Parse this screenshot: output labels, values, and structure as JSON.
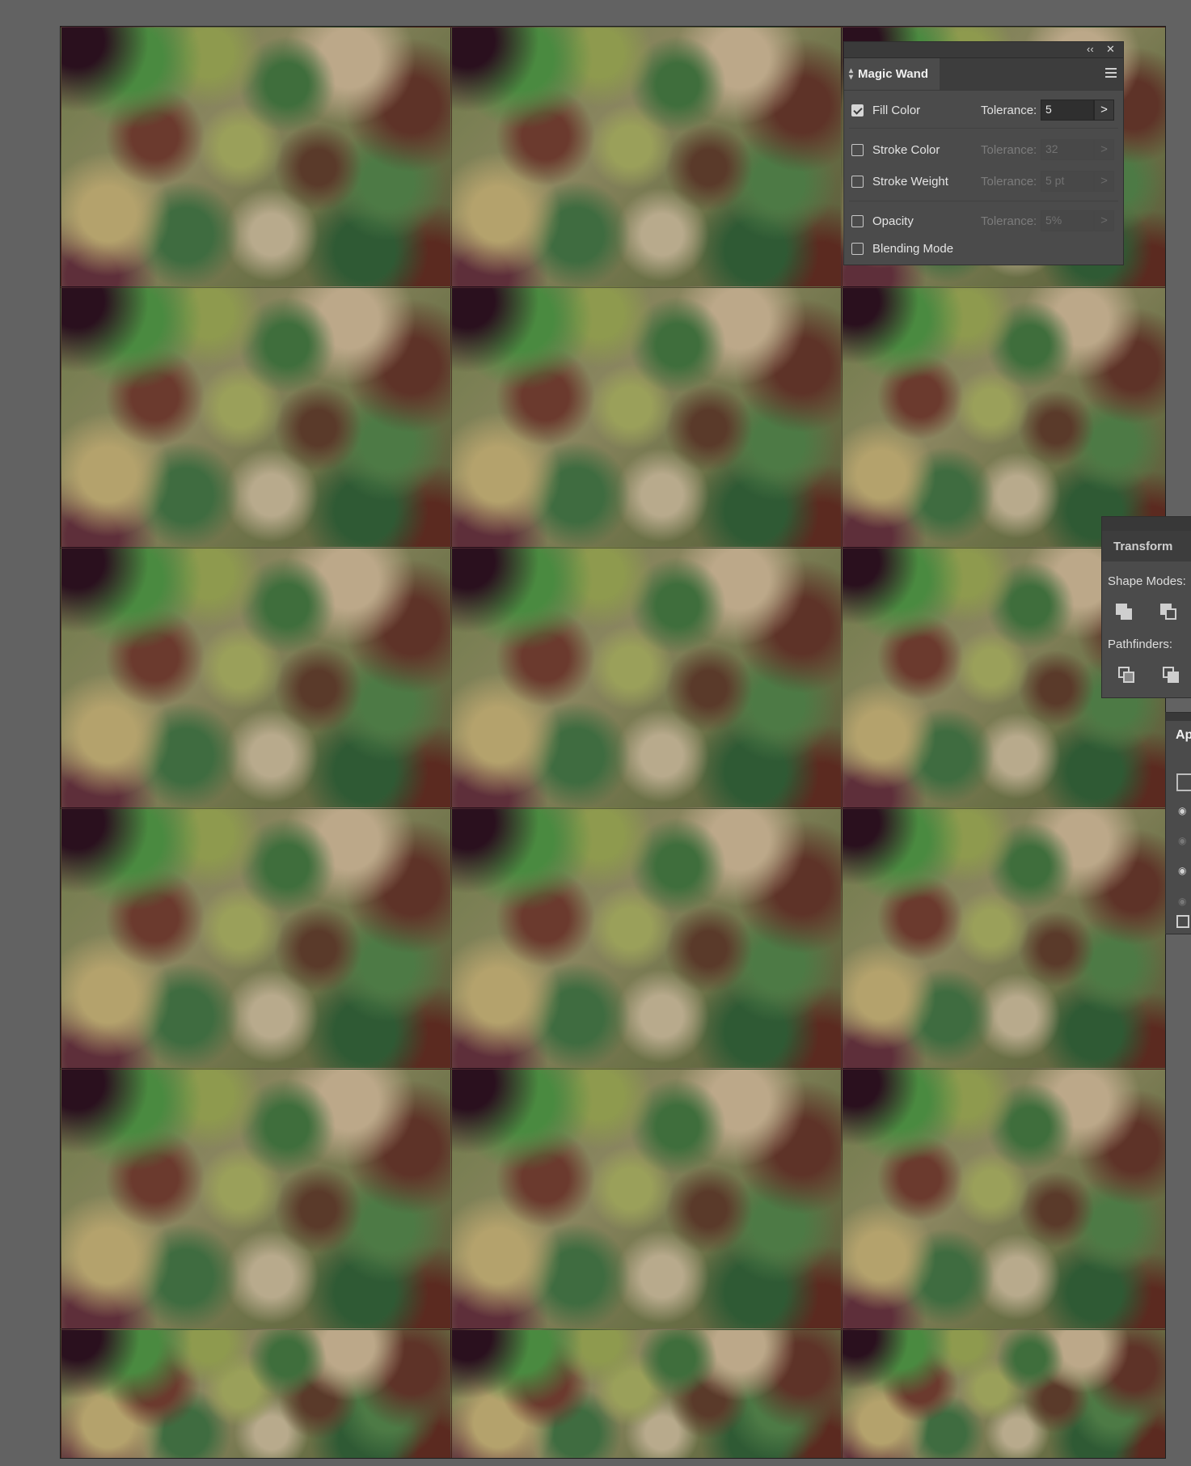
{
  "canvas": {
    "rows": 6,
    "cols": 3
  },
  "magic_wand": {
    "title": "Magic Wand",
    "collapse_label": "‹‹",
    "close_label": "✕",
    "options": [
      {
        "label": "Fill Color",
        "checked": true,
        "tolerance_label": "Tolerance:",
        "tolerance": "5",
        "enabled": true
      },
      {
        "label": "Stroke Color",
        "checked": false,
        "tolerance_label": "Tolerance:",
        "tolerance": "32",
        "enabled": false
      },
      {
        "label": "Stroke Weight",
        "checked": false,
        "tolerance_label": "Tolerance:",
        "tolerance": "5 pt",
        "enabled": false
      },
      {
        "label": "Opacity",
        "checked": false,
        "tolerance_label": "Tolerance:",
        "tolerance": "5%",
        "enabled": false
      },
      {
        "label": "Blending Mode",
        "checked": false
      }
    ]
  },
  "pathfinder": {
    "tab": "Transform",
    "shape_modes_label": "Shape Modes:",
    "pathfinders_label": "Pathfinders:"
  },
  "appearance": {
    "tab": "Ap"
  }
}
